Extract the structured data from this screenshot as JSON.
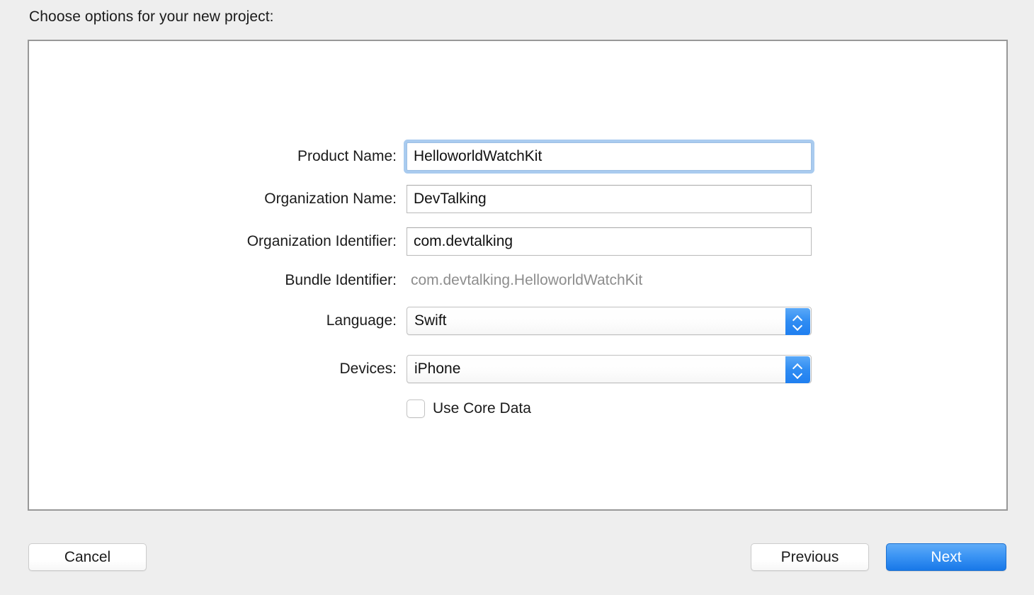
{
  "dialog": {
    "title": "Choose options for your new project:"
  },
  "form": {
    "rows": [
      {
        "label": "Product Name:",
        "value": "HelloworldWatchKit",
        "type": "text",
        "focused": true
      },
      {
        "label": "Organization Name:",
        "value": "DevTalking",
        "type": "text",
        "focused": false
      },
      {
        "label": "Organization Identifier:",
        "value": "com.devtalking",
        "type": "text",
        "focused": false
      },
      {
        "label": "Bundle Identifier:",
        "value": "com.devtalking.HelloworldWatchKit",
        "type": "static",
        "focused": false
      },
      {
        "label": "Language:",
        "value": "Swift",
        "type": "popup",
        "focused": false
      },
      {
        "label": "Devices:",
        "value": "iPhone",
        "type": "popup",
        "focused": false
      }
    ],
    "checkbox": {
      "label": "Use Core Data",
      "checked": false
    }
  },
  "footer": {
    "cancel_label": "Cancel",
    "previous_label": "Previous",
    "next_label": "Next"
  },
  "colors": {
    "window_background": "#eeeeee",
    "panel_background": "#ffffff",
    "panel_border": "#989898",
    "focus_ring": "#a9cbef",
    "accent_blue": "#1878e8",
    "stepper_blue": "#2f8cf2",
    "static_text": "#8d8d8d",
    "text": "#1b1b1b"
  }
}
